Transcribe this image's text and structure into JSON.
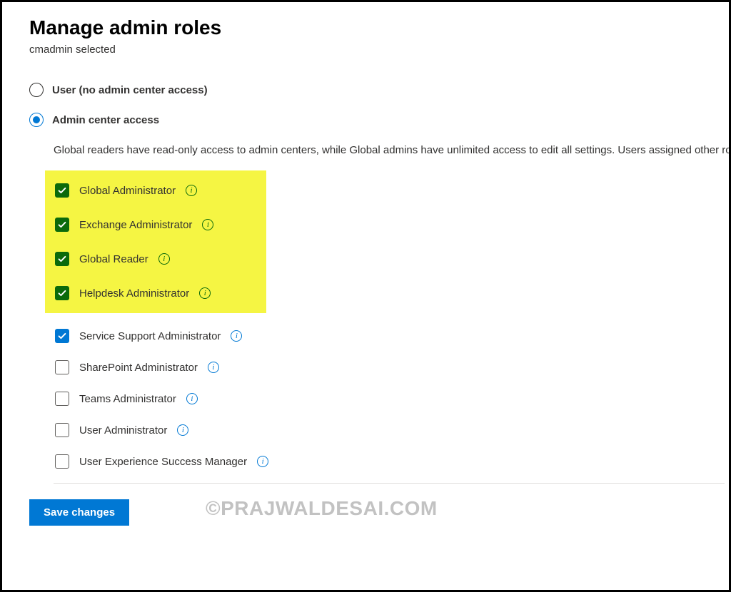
{
  "header": {
    "title": "Manage admin roles",
    "subtitle": "cmadmin selected"
  },
  "radios": {
    "user_no_access": "User (no admin center access)",
    "admin_access": "Admin center access"
  },
  "description": "Global readers have read-only access to admin centers, while Global admins have unlimited access to edit all settings. Users assigned other roles are more limited in what they can see and do.",
  "roles": {
    "global_admin": "Global Administrator",
    "exchange_admin": "Exchange Administrator",
    "global_reader": "Global Reader",
    "helpdesk_admin": "Helpdesk Administrator",
    "service_support_admin": "Service Support Administrator",
    "sharepoint_admin": "SharePoint Administrator",
    "teams_admin": "Teams Administrator",
    "user_admin": "User Administrator",
    "ux_success_manager": "User Experience Success Manager"
  },
  "buttons": {
    "save": "Save changes"
  },
  "watermark": "©PRAJWALDESAI.COM"
}
